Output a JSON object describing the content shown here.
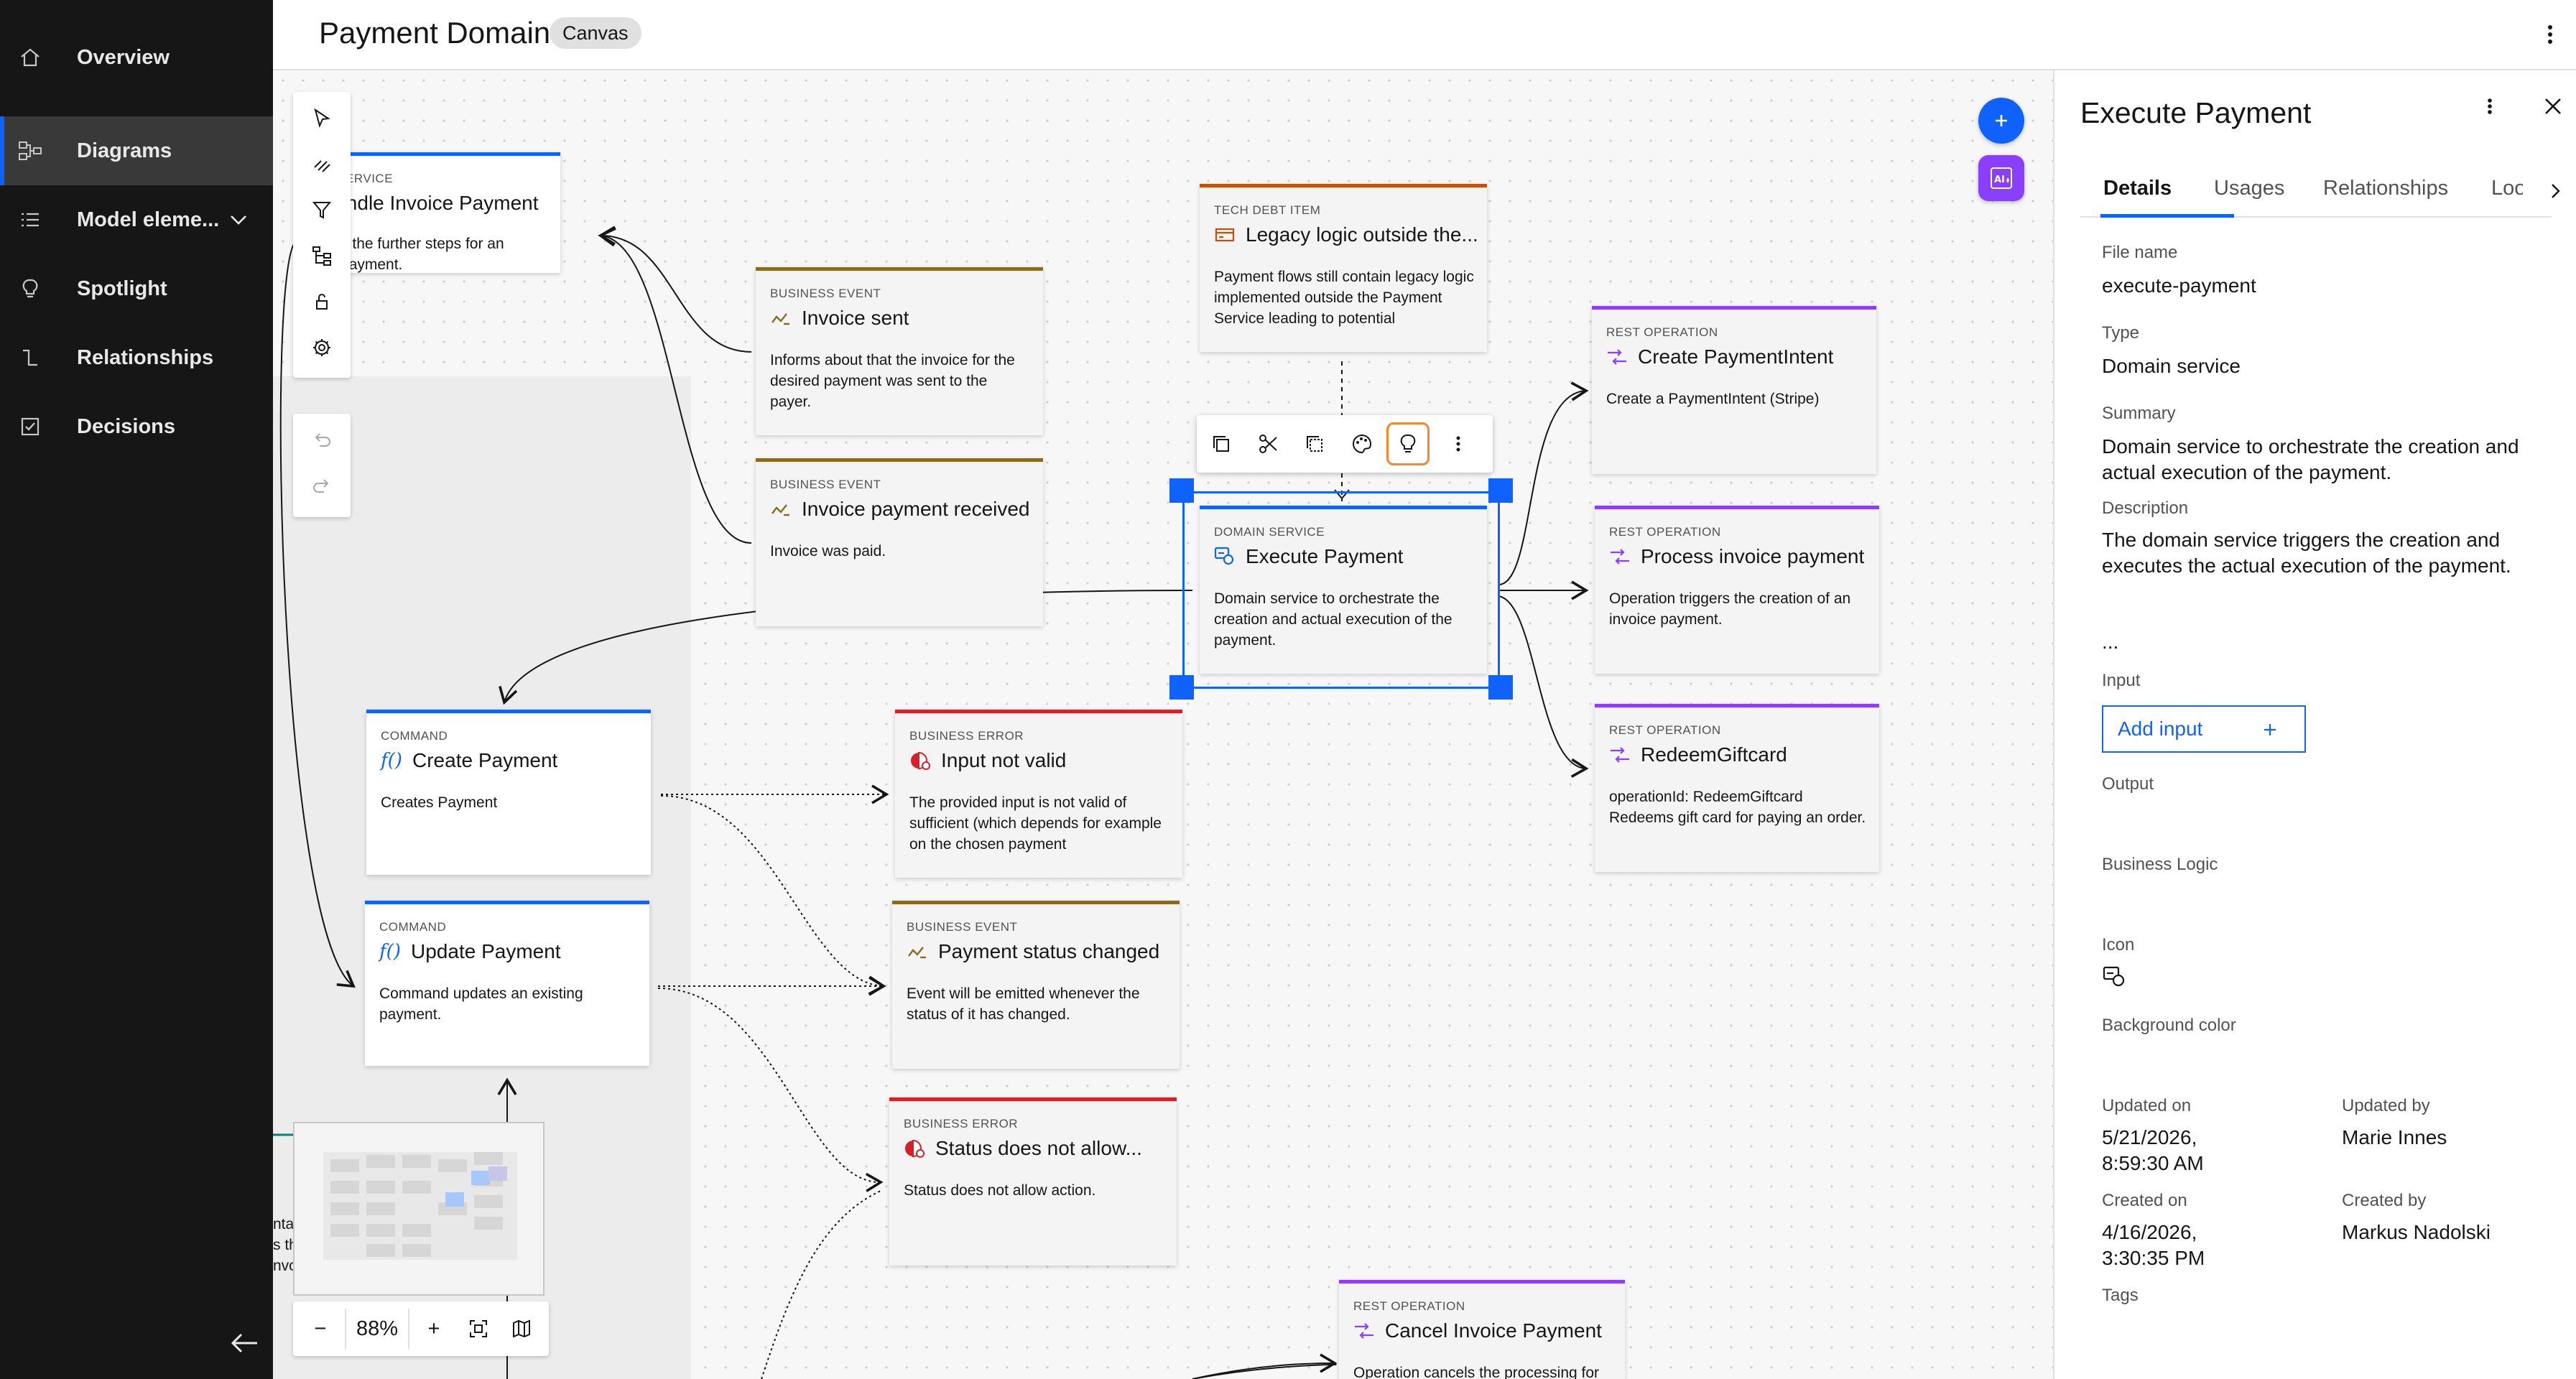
{
  "app": {
    "title": "Payment Domain",
    "tag": "Canvas"
  },
  "sidebar": {
    "items": [
      {
        "label": "Overview",
        "icon": "home-icon"
      },
      {
        "label": "Diagrams",
        "icon": "diagram-icon",
        "active": true
      },
      {
        "label": "Model eleme...",
        "icon": "list-icon"
      },
      {
        "label": "Spotlight",
        "icon": "lightbulb-icon"
      },
      {
        "label": "Relationships",
        "icon": "relationship-icon"
      },
      {
        "label": "Decisions",
        "icon": "checkbox-icon"
      }
    ]
  },
  "canvas": {
    "nodes": {
      "handle_invoice": {
        "type": "IN SERVICE",
        "title": "Handle Invoice Payment",
        "desc": "dles the further steps for an\nce payment."
      },
      "invoice_sent": {
        "type": "BUSINESS EVENT",
        "title": "Invoice sent",
        "desc": "Informs about that the invoice for the desired payment was sent to the payer."
      },
      "invoice_received": {
        "type": "BUSINESS EVENT",
        "title": "Invoice payment received",
        "desc": "Invoice was paid."
      },
      "tech_debt": {
        "type": "TECH DEBT ITEM",
        "title": "Legacy logic outside the...",
        "desc": "Payment flows still contain legacy logic implemented outside the Payment Service leading to potential"
      },
      "execute_payment": {
        "type": "DOMAIN SERVICE",
        "title": "Execute Payment",
        "desc": "Domain service to orchestrate the creation and actual execution of the payment."
      },
      "create_intent": {
        "type": "REST OPERATION",
        "title": "Create PaymentIntent",
        "desc": "Create a PaymentIntent (Stripe)"
      },
      "process_invoice": {
        "type": "REST OPERATION",
        "title": "Process invoice payment",
        "desc": "Operation triggers the creation of an invoice payment."
      },
      "redeem_gift": {
        "type": "REST OPERATION",
        "title": "RedeemGiftcard",
        "desc": "operationId: RedeemGiftcard Redeems gift card for paying an order."
      },
      "create_payment": {
        "type": "COMMAND",
        "title": "Create Payment",
        "desc": "Creates Payment"
      },
      "update_payment": {
        "type": "COMMAND",
        "title": "Update Payment",
        "desc": "Command updates an existing payment."
      },
      "input_not_valid": {
        "type": "BUSINESS ERROR",
        "title": "Input not valid",
        "desc": "The provided input is not valid of sufficient (which depends for example on the chosen payment"
      },
      "status_changed": {
        "type": "BUSINESS EVENT",
        "title": "Payment status changed",
        "desc": "Event will be emitted whenever the status of it has changed."
      },
      "status_not_allow": {
        "type": "BUSINESS ERROR",
        "title": "Status does not allow...",
        "desc": "Status does not allow action."
      },
      "cancel_invoice": {
        "type": "REST OPERATION",
        "title": "Cancel Invoice Payment",
        "desc": "Operation cancels the processing for"
      },
      "partial_left": {
        "desc": "nta\ns th\nnvo"
      }
    },
    "zoom": "88%"
  },
  "panel": {
    "title": "Execute Payment",
    "tabs": [
      "Details",
      "Usages",
      "Relationships",
      "Loo"
    ],
    "file_name_label": "File name",
    "file_name": "execute-payment",
    "type_label": "Type",
    "type": "Domain service",
    "summary_label": "Summary",
    "summary": "Domain service to orchestrate the creation and actual execution of the payment.",
    "description_label": "Description",
    "description": "The domain service triggers the creation and executes the actual execution of the payment.",
    "ellipsis": "...",
    "input_label": "Input",
    "add_input": "Add input",
    "output_label": "Output",
    "business_logic_label": "Business Logic",
    "icon_label": "Icon",
    "bg_color_label": "Background color",
    "updated_on_label": "Updated on",
    "updated_on": "5/21/2026, 8:59:30 AM",
    "updated_by_label": "Updated by",
    "updated_by": "Marie Innes",
    "created_on_label": "Created on",
    "created_on": "4/16/2026, 3:30:35 PM",
    "created_by_label": "Created by",
    "created_by": "Markus Nadolski",
    "tags_label": "Tags"
  },
  "colors": {
    "accent": "#0f62fe",
    "sidebar_bg": "#161616",
    "business_event": "#8a6a1e",
    "business_error": "#da1e28",
    "rest_operation": "#8a3ffc",
    "tech_debt": "#c1520d",
    "command": "#0f62fe",
    "ai_button": "#8a3ffc",
    "highlight": "#ff832b"
  }
}
